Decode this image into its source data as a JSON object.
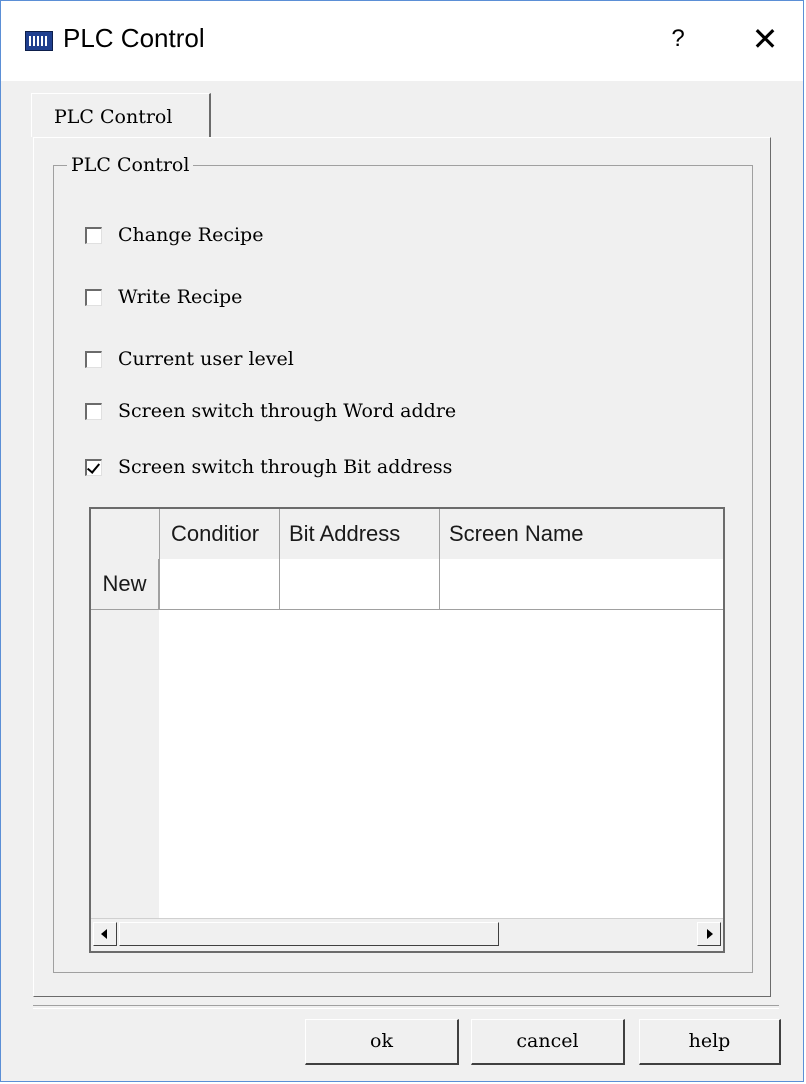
{
  "window": {
    "title": "PLC Control"
  },
  "titlebar": {
    "help_glyph": "?",
    "close_glyph": "✕"
  },
  "tab": {
    "label": "PLC Control"
  },
  "group": {
    "title": "PLC Control"
  },
  "checkboxes": [
    {
      "label": "Change Recipe",
      "checked": false
    },
    {
      "label": "Write Recipe",
      "checked": false
    },
    {
      "label": "Current user level",
      "checked": false
    },
    {
      "label": "Screen switch through Word addre",
      "checked": false
    },
    {
      "label": "Screen switch through Bit address",
      "checked": true
    }
  ],
  "table": {
    "columns": [
      "Conditior",
      "Bit Address",
      "Screen Name"
    ],
    "row_label": "New"
  },
  "buttons": {
    "ok": "ok",
    "cancel": "cancel",
    "help": "help"
  },
  "icons": {
    "app": "hmi-app-icon",
    "help": "question-mark-icon",
    "close": "close-icon",
    "scroll_left": "triangle-left-icon",
    "scroll_right": "triangle-right-icon"
  }
}
